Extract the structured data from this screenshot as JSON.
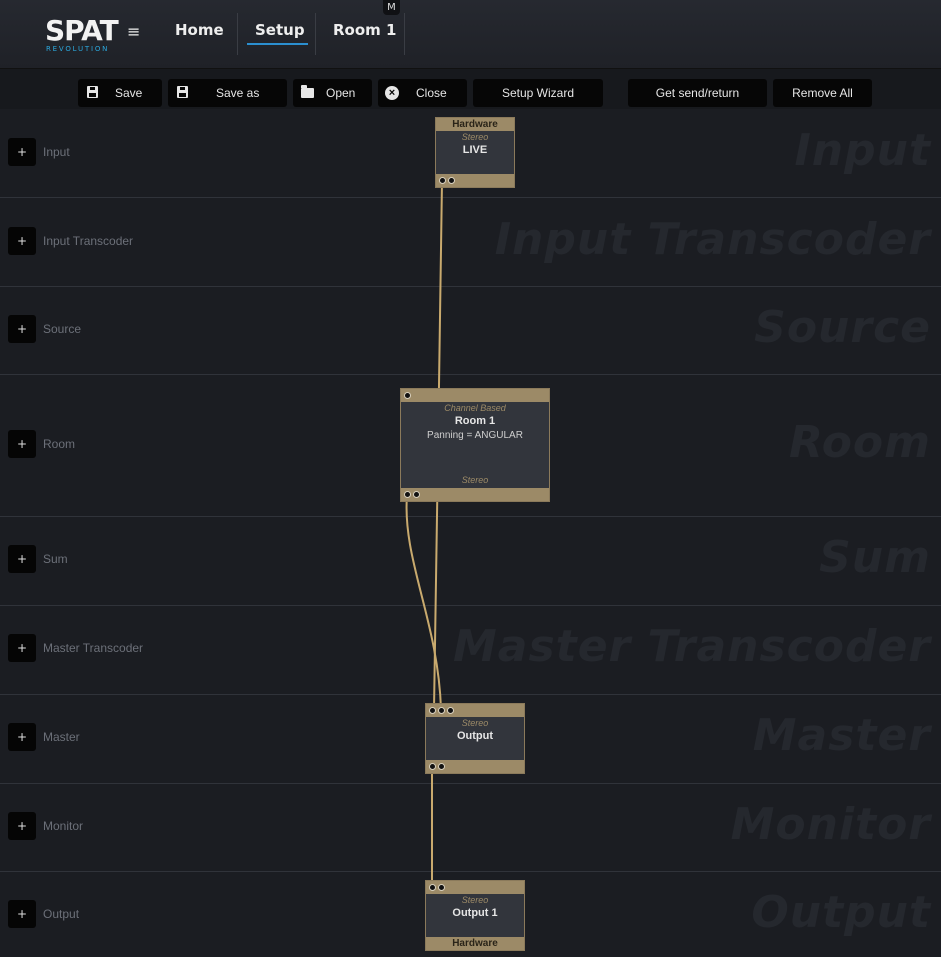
{
  "header": {
    "logo_main": "SPAT",
    "logo_sub": "REVOLUTION",
    "menu_glyph": "≡",
    "tabs": [
      {
        "label": "Home"
      },
      {
        "label": "Setup",
        "active": true
      },
      {
        "label": "Room 1"
      }
    ],
    "badge": "M"
  },
  "toolbar": {
    "save": "Save",
    "save_as": "Save as",
    "open": "Open",
    "close": "Close",
    "setup_wizard": "Setup Wizard",
    "get_send_return": "Get send/return",
    "remove_all": "Remove All"
  },
  "rows": [
    {
      "label": "Input",
      "ghost": "Input",
      "plus": "+"
    },
    {
      "label": "Input Transcoder",
      "ghost": "Input Transcoder",
      "plus": "+"
    },
    {
      "label": "Source",
      "ghost": "Source",
      "plus": "+"
    },
    {
      "label": "Room",
      "ghost": "Room",
      "plus": "+"
    },
    {
      "label": "Sum",
      "ghost": "Sum",
      "plus": "+"
    },
    {
      "label": "Master Transcoder",
      "ghost": "Master Transcoder",
      "plus": "+"
    },
    {
      "label": "Master",
      "ghost": "Master",
      "plus": "+"
    },
    {
      "label": "Monitor",
      "ghost": "Monitor",
      "plus": "+"
    },
    {
      "label": "Output",
      "ghost": "Output",
      "plus": "+"
    }
  ],
  "nodes": {
    "input_live": {
      "top_label": "Hardware",
      "format": "Stereo",
      "name": "LIVE"
    },
    "room1": {
      "type": "Channel Based",
      "name": "Room 1",
      "panning": "Panning = ANGULAR",
      "format": "Stereo"
    },
    "master_output": {
      "format": "Stereo",
      "name": "Output"
    },
    "output1": {
      "format": "Stereo",
      "name": "Output 1",
      "bottom_label": "Hardware"
    }
  },
  "colors": {
    "wire": "#c9aa6e",
    "node_bar": "#9c8a67",
    "accent": "#2b8fd0"
  }
}
